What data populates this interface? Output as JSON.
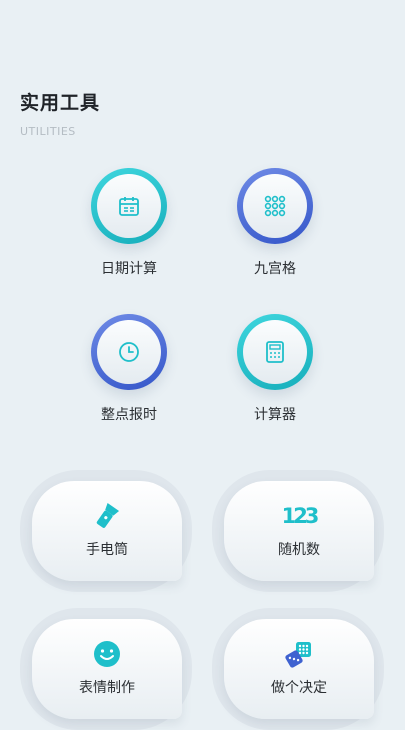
{
  "header": {
    "title": "实用工具",
    "subtitle": "UTILITIES"
  },
  "tools": [
    {
      "label": "日期计算",
      "icon": "calendar-icon",
      "ring": "cyan"
    },
    {
      "label": "九宫格",
      "icon": "grid-icon",
      "ring": "blue"
    },
    {
      "label": "整点报时",
      "icon": "clock-icon",
      "ring": "blue"
    },
    {
      "label": "计算器",
      "icon": "calculator-icon",
      "ring": "cyan"
    }
  ],
  "cards": [
    {
      "label": "手电筒",
      "icon": "flashlight-icon"
    },
    {
      "label": "随机数",
      "icon": "random-number-icon",
      "icon_text": "123"
    },
    {
      "label": "表情制作",
      "icon": "smiley-icon"
    },
    {
      "label": "做个决定",
      "icon": "dice-icon"
    }
  ],
  "colors": {
    "cyan": "#1fbfca",
    "blue": "#3f62d0",
    "background": "#e9f0f4"
  }
}
